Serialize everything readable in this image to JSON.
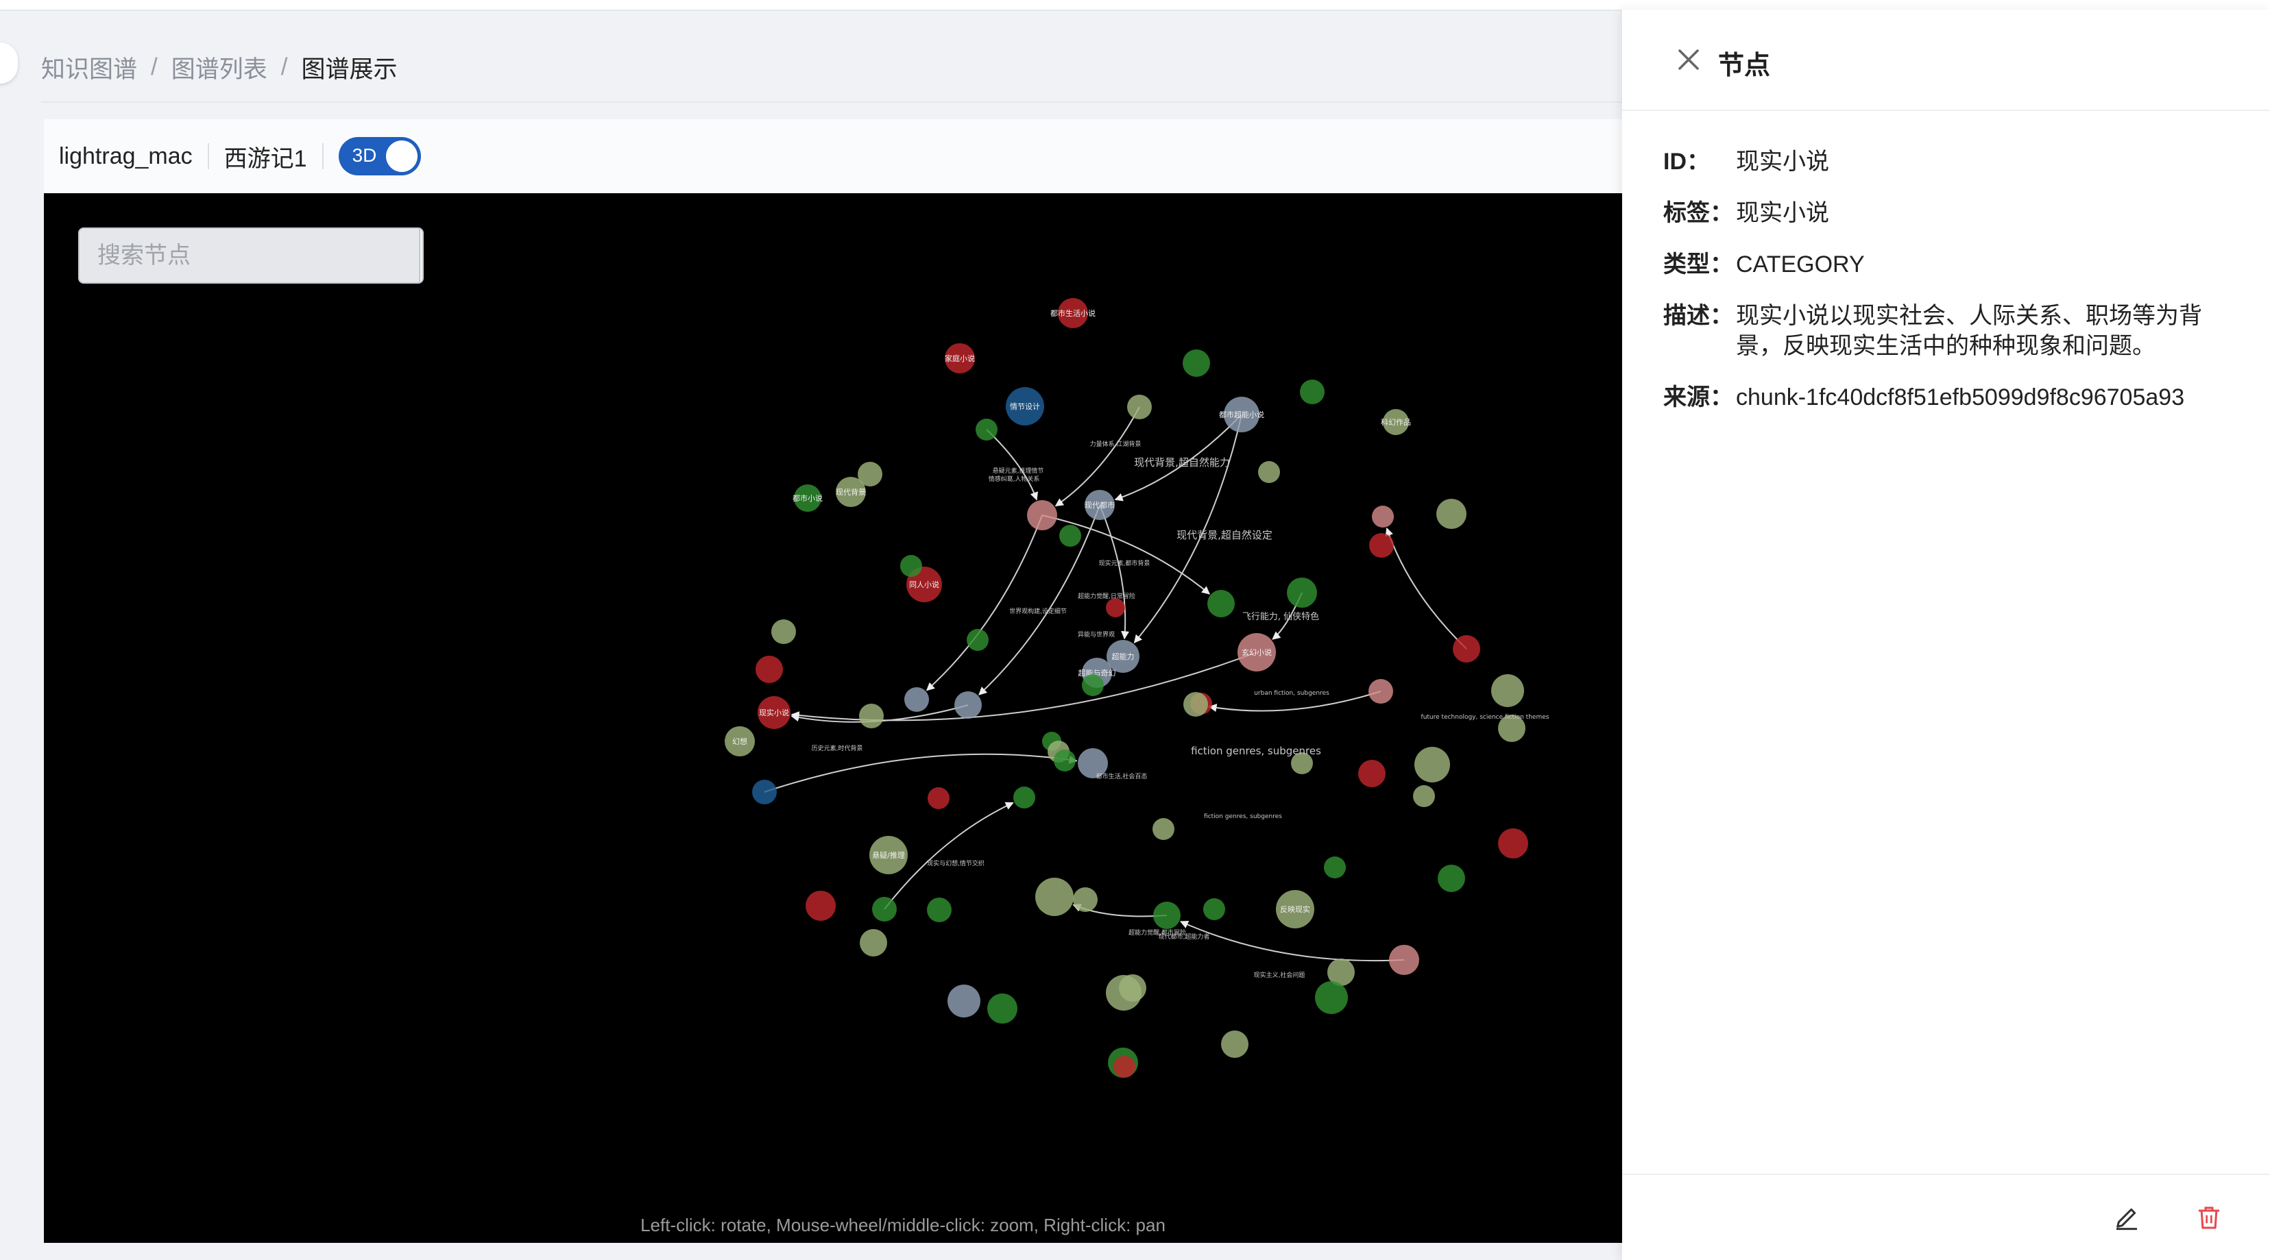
{
  "breadcrumb": {
    "items": [
      "知识图谱",
      "图谱列表",
      "图谱展示"
    ],
    "separator": "/"
  },
  "toolbar": {
    "workspace": "lightrag_mac",
    "graph_name": "西游记1",
    "mode_toggle": {
      "label": "3D",
      "on": true
    }
  },
  "search": {
    "placeholder": "搜索节点",
    "icon": "search-icon"
  },
  "canvas": {
    "hint": "Left-click: rotate, Mouse-wheel/middle-click: zoom, Right-click: pan",
    "background": "#000000"
  },
  "graph": {
    "colors": {
      "red": "#c0262b",
      "green": "#2f8f2f",
      "blue": "#1f5f99",
      "gray": "#8fa0b5",
      "olive": "#9db27a",
      "pink": "#d48a8a"
    },
    "nodes": [
      {
        "id": "n1",
        "label": "都市生活小说",
        "color": "red"
      },
      {
        "id": "n2",
        "label": "家庭小说",
        "color": "red"
      },
      {
        "id": "n3",
        "label": "情节设计",
        "color": "blue"
      },
      {
        "id": "n4",
        "label": "",
        "color": "green"
      },
      {
        "id": "n5",
        "label": "",
        "color": "olive"
      },
      {
        "id": "n6",
        "label": "都市超能小说",
        "color": "gray"
      },
      {
        "id": "n7",
        "label": "",
        "color": "green"
      },
      {
        "id": "n8",
        "label": "科幻作品",
        "color": "olive"
      },
      {
        "id": "n9",
        "label": "",
        "color": "green"
      },
      {
        "id": "n10",
        "label": "",
        "color": "olive"
      },
      {
        "id": "n11",
        "label": "",
        "color": "pink"
      },
      {
        "id": "n12",
        "label": "现代都市",
        "color": "gray"
      },
      {
        "id": "n13",
        "label": "",
        "color": "green"
      },
      {
        "id": "n14",
        "label": "都市小说",
        "color": "green"
      },
      {
        "id": "n15",
        "label": "超能力",
        "color": "gray"
      },
      {
        "id": "n16",
        "label": "",
        "color": "green"
      },
      {
        "id": "n17",
        "label": "",
        "color": "pink"
      },
      {
        "id": "n18",
        "label": "现代背景",
        "color": "olive"
      },
      {
        "id": "n19",
        "label": "",
        "color": "olive"
      },
      {
        "id": "n20",
        "label": "同人小说",
        "color": "red"
      },
      {
        "id": "n21",
        "label": "",
        "color": "red"
      },
      {
        "id": "n22",
        "label": "",
        "color": "green"
      },
      {
        "id": "n23",
        "label": "",
        "color": "green"
      },
      {
        "id": "n24",
        "label": "",
        "color": "olive"
      },
      {
        "id": "n25",
        "label": "",
        "color": "green"
      },
      {
        "id": "n26",
        "label": "玄幻小说",
        "color": "pink"
      },
      {
        "id": "n27",
        "label": "超能与奇幻",
        "color": "gray"
      },
      {
        "id": "n28",
        "label": "",
        "color": "green"
      },
      {
        "id": "n29",
        "label": "",
        "color": "red"
      },
      {
        "id": "n30",
        "label": "幻想",
        "color": "olive"
      },
      {
        "id": "n31",
        "label": "现实小说",
        "color": "red"
      },
      {
        "id": "n32",
        "label": "",
        "color": "gray"
      },
      {
        "id": "n33",
        "label": "",
        "color": "gray"
      },
      {
        "id": "n34",
        "label": "",
        "color": "olive"
      },
      {
        "id": "n35",
        "label": "",
        "color": "pink"
      },
      {
        "id": "n36",
        "label": "",
        "color": "red"
      },
      {
        "id": "n37",
        "label": "",
        "color": "olive"
      },
      {
        "id": "n38",
        "label": "",
        "color": "olive"
      },
      {
        "id": "n39",
        "label": "",
        "color": "green"
      },
      {
        "id": "n40",
        "label": "",
        "color": "blue"
      },
      {
        "id": "n41",
        "label": "",
        "color": "olive"
      },
      {
        "id": "n42",
        "label": "",
        "color": "gray"
      },
      {
        "id": "n43",
        "label": "",
        "color": "green"
      },
      {
        "id": "n44",
        "label": "",
        "color": "olive"
      },
      {
        "id": "n45",
        "label": "",
        "color": "red"
      },
      {
        "id": "n46",
        "label": "",
        "color": "green"
      },
      {
        "id": "n47",
        "label": "",
        "color": "olive"
      },
      {
        "id": "n48",
        "label": "",
        "color": "red"
      },
      {
        "id": "n49",
        "label": "",
        "color": "olive"
      },
      {
        "id": "n50",
        "label": "",
        "color": "olive"
      },
      {
        "id": "n51",
        "label": "悬疑/推理",
        "color": "olive"
      },
      {
        "id": "n52",
        "label": "",
        "color": "red"
      },
      {
        "id": "n53",
        "label": "",
        "color": "green"
      },
      {
        "id": "n54",
        "label": "",
        "color": "olive"
      },
      {
        "id": "n55",
        "label": "",
        "color": "olive"
      },
      {
        "id": "n56",
        "label": "",
        "color": "green"
      },
      {
        "id": "n57",
        "label": "",
        "color": "green"
      },
      {
        "id": "n58",
        "label": "反映现实",
        "color": "olive"
      },
      {
        "id": "n59",
        "label": "",
        "color": "green"
      },
      {
        "id": "n60",
        "label": "",
        "color": "pink"
      },
      {
        "id": "n61",
        "label": "",
        "color": "olive"
      },
      {
        "id": "n62",
        "label": "",
        "color": "green"
      },
      {
        "id": "n63",
        "label": "",
        "color": "gray"
      },
      {
        "id": "n64",
        "label": "",
        "color": "green"
      },
      {
        "id": "n65",
        "label": "",
        "color": "olive"
      },
      {
        "id": "n66",
        "label": "",
        "color": "olive"
      },
      {
        "id": "n67",
        "label": "",
        "color": "red"
      },
      {
        "id": "n68",
        "label": "",
        "color": "green"
      },
      {
        "id": "n69",
        "label": "",
        "color": "olive"
      },
      {
        "id": "n70",
        "label": "",
        "color": "green"
      },
      {
        "id": "n71",
        "label": "",
        "color": "red"
      },
      {
        "id": "n72",
        "label": "",
        "color": "red"
      },
      {
        "id": "n73",
        "label": "",
        "color": "olive"
      },
      {
        "id": "n74",
        "label": "",
        "color": "olive"
      },
      {
        "id": "n75",
        "label": "",
        "color": "red"
      },
      {
        "id": "n76",
        "label": "",
        "color": "green"
      },
      {
        "id": "n77",
        "label": "",
        "color": "olive"
      }
    ],
    "edges": [
      {
        "from": "n6",
        "to": "n12"
      },
      {
        "from": "n6",
        "to": "n15"
      },
      {
        "from": "n5",
        "to": "n11"
      },
      {
        "from": "n4",
        "to": "n11"
      },
      {
        "from": "n11",
        "to": "n22"
      },
      {
        "from": "n11",
        "to": "n33"
      },
      {
        "from": "n12",
        "to": "n15"
      },
      {
        "from": "n12",
        "to": "n32"
      },
      {
        "from": "n26",
        "to": "n31"
      },
      {
        "from": "n16",
        "to": "n26"
      },
      {
        "from": "n35",
        "to": "n37"
      },
      {
        "from": "n36",
        "to": "n17"
      },
      {
        "from": "n32",
        "to": "n31"
      },
      {
        "from": "n40",
        "to": "n42"
      },
      {
        "from": "n53",
        "to": "n46"
      },
      {
        "from": "n60",
        "to": "n56"
      },
      {
        "from": "n56",
        "to": "n54"
      }
    ],
    "edge_labels": [
      {
        "text": "现代背景,超自然设定",
        "size": "md"
      },
      {
        "text": "现代背景,超自然能力",
        "size": "md"
      },
      {
        "text": "fiction genres, subgenres",
        "size": "md"
      },
      {
        "text": "飞行能力, 仙侠特色",
        "size": "sm"
      },
      {
        "text": "urban fiction, subgenres",
        "size": "xs"
      },
      {
        "text": "future technology, science fiction themes",
        "size": "xs"
      },
      {
        "text": "fiction genres, subgenres",
        "size": "xs"
      },
      {
        "text": "世界观构建,设定细节",
        "size": "xs"
      },
      {
        "text": "异能与世界观",
        "size": "xs"
      },
      {
        "text": "超能力觉醒,日常冒险",
        "size": "xs"
      },
      {
        "text": "力量体系,江湖背景",
        "size": "xs"
      },
      {
        "text": "悬疑元素,推理情节",
        "size": "xs"
      },
      {
        "text": "情感纠葛,人物关系",
        "size": "xs"
      },
      {
        "text": "现实元素,都市背景",
        "size": "xs"
      },
      {
        "text": "历史元素,时代背景",
        "size": "xs"
      },
      {
        "text": "现实主义,社会问题",
        "size": "xs"
      },
      {
        "text": "超能力觉醒,都市冒险",
        "size": "xs"
      },
      {
        "text": "现实与幻想,情节交织",
        "size": "xs"
      },
      {
        "text": "现代都市,超能力者",
        "size": "xs"
      },
      {
        "text": "都市生活,社会百态",
        "size": "xs"
      }
    ]
  },
  "panel": {
    "title": "节点",
    "close_icon": "close-icon",
    "fields": [
      {
        "key": "ID",
        "colon": "：",
        "value": "现实小说"
      },
      {
        "key": "标签",
        "colon": "：",
        "value": "现实小说"
      },
      {
        "key": "类型",
        "colon": "：",
        "value": "CATEGORY"
      },
      {
        "key": "描述",
        "colon": "：",
        "value": "现实小说以现实社会、人际关系、职场等为背景，反映现实生活中的种种现象和问题。"
      },
      {
        "key": "来源",
        "colon": "：",
        "value": "chunk-1fc40dcf8f51efb5099d9f8c96705a93"
      }
    ],
    "footer": {
      "edit_icon": "edit-icon",
      "delete_icon": "delete-icon",
      "delete_color": "#e5484d"
    }
  }
}
